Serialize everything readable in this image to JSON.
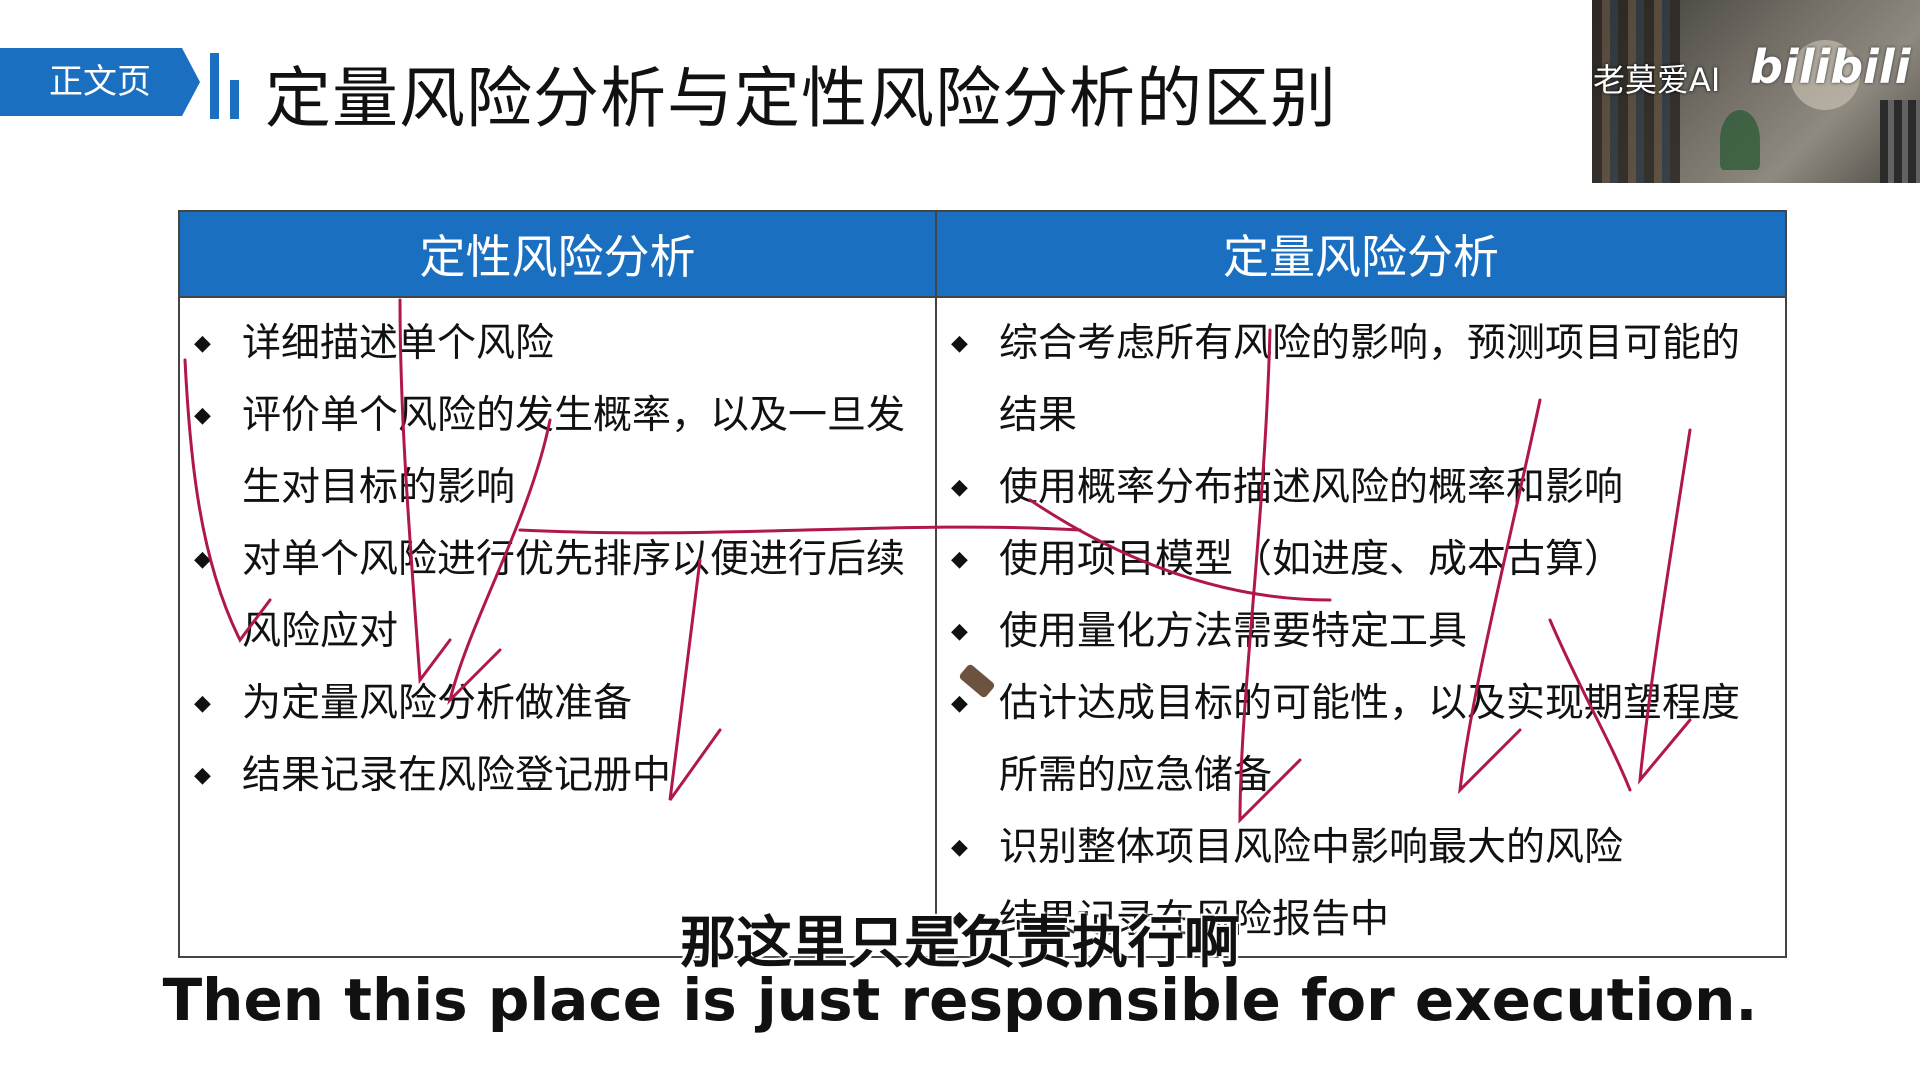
{
  "slide_tag": "正文页",
  "page_title": "定量风险分析与定性风险分析的区别",
  "video_overlay": {
    "author": "老莫爱AI",
    "logo": "bilibili"
  },
  "table": {
    "headers": [
      "定性风险分析",
      "定量风险分析"
    ],
    "qualitative": [
      "详细描述单个风险",
      "评价单个风险的发生概率，以及一旦发生对目标的影响",
      "对单个风险进行优先排序以便进行后续风险应对",
      "为定量风险分析做准备",
      "结果记录在风险登记册中"
    ],
    "quantitative": [
      "综合考虑所有风险的影响，预测项目可能的结果",
      "使用概率分布描述风险的概率和影响",
      "使用项目模型（如进度、成本古算）",
      "使用量化方法需要特定工具",
      "估计达成目标的可能性，以及实现期望程度所需的应急储备",
      "识别整体项目风险中影响最大的风险",
      "结果记录在风险报告中"
    ]
  },
  "subtitles": {
    "chinese": "那这里只是负责执行啊",
    "english": "Then this place is just responsible for execution."
  },
  "colors": {
    "accent": "#1a6fc1",
    "annotation": "#b0174c"
  }
}
